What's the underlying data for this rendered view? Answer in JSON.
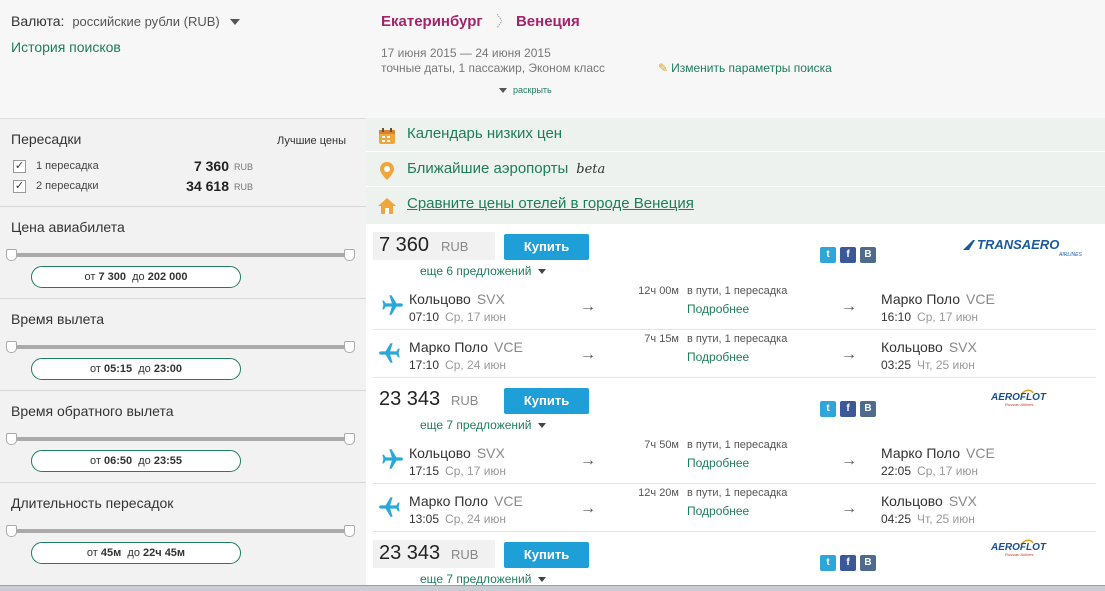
{
  "header": {
    "currency_label": "Валюта:",
    "currency_value": "российские рубли (RUB)",
    "history_link": "История поисков",
    "route_from": "Екатеринбург",
    "route_to": "Венеция",
    "dates": "17 июня 2015  — 24 июня 2015",
    "params": "точные даты, 1 пассажир, Эконом класс",
    "edit_link": "Изменить параметры поиска",
    "expand_link": "раскрыть"
  },
  "filters": {
    "stops": {
      "title": "Пересадки",
      "best_prices_label": "Лучшие цены",
      "options": [
        {
          "label": "1 пересадка",
          "price": "7 360",
          "currency": "RUB",
          "checked": true
        },
        {
          "label": "2 пересадки",
          "price": "34 618",
          "currency": "RUB",
          "checked": true
        }
      ]
    },
    "ticket_price": {
      "title": "Цена авиабилета",
      "from_label": "от",
      "from": "7 300",
      "to_label": "до",
      "to": "202 000"
    },
    "departure_time": {
      "title": "Время вылета",
      "from_label": "от",
      "from": "05:15",
      "to_label": "до",
      "to": "23:00"
    },
    "return_time": {
      "title": "Время обратного вылета",
      "from_label": "от",
      "from": "06:50",
      "to_label": "до",
      "to": "23:55"
    },
    "layover_duration": {
      "title": "Длительность пересадок",
      "from_label": "от",
      "from": "45м",
      "to_label": "до",
      "to": "22ч 45м"
    }
  },
  "links": {
    "calendar": "Календарь низких цен",
    "airports": "Ближайшие аэропорты",
    "airports_badge": "beta",
    "hotels": "Сравните цены отелей в городе Венеция"
  },
  "buy_label": "Купить",
  "social": {
    "twitter": "t",
    "facebook": "f",
    "vk": "B"
  },
  "offers": [
    {
      "price": "7 360",
      "currency": "RUB",
      "more_offers": "еще 6 предложений",
      "airline": "TRANSAERO",
      "airline_sub": "AIRLINES",
      "segments": [
        {
          "from": "Кольцово",
          "from_code": "SVX",
          "dep_time": "07:10",
          "dep_date": "Ср, 17 июн",
          "duration": "12ч 00м",
          "in_way": "в пути,   1 пересадка",
          "details": "Подробнее",
          "to": "Марко Поло",
          "to_code": "VCE",
          "arr_time": "16:10",
          "arr_date": "Ср, 17 июн"
        },
        {
          "from": "Марко Поло",
          "from_code": "VCE",
          "dep_time": "17:10",
          "dep_date": "Ср, 24 июн",
          "duration": "7ч 15м",
          "in_way": "в пути,   1 пересадка",
          "details": "Подробнее",
          "to": "Кольцово",
          "to_code": "SVX",
          "arr_time": "03:25",
          "arr_date": "Чт, 25 июн"
        }
      ]
    },
    {
      "price": "23 343",
      "currency": "RUB",
      "more_offers": "еще 7 предложений",
      "airline": "AEROFLOT",
      "airline_sub": "Russian Airlines",
      "segments": [
        {
          "from": "Кольцово",
          "from_code": "SVX",
          "dep_time": "17:15",
          "dep_date": "Ср, 17 июн",
          "duration": "7ч 50м",
          "in_way": "в пути,   1 пересадка",
          "details": "Подробнее",
          "to": "Марко Поло",
          "to_code": "VCE",
          "arr_time": "22:05",
          "arr_date": "Ср, 17 июн"
        },
        {
          "from": "Марко Поло",
          "from_code": "VCE",
          "dep_time": "13:05",
          "dep_date": "Ср, 24 июн",
          "duration": "12ч 20м",
          "in_way": "в пути,   1 пересадка",
          "details": "Подробнее",
          "to": "Кольцово",
          "to_code": "SVX",
          "arr_time": "04:25",
          "arr_date": "Чт, 25 июн"
        }
      ]
    },
    {
      "price": "23 343",
      "currency": "RUB",
      "more_offers": "еще 7 предложений",
      "airline": "AEROFLOT",
      "airline_sub": "Russian Airlines"
    }
  ],
  "colors": {
    "accent": "#1e7d5a",
    "route": "#a3246b",
    "buy": "#1f9fd7",
    "plane": "#2aa9d8"
  }
}
